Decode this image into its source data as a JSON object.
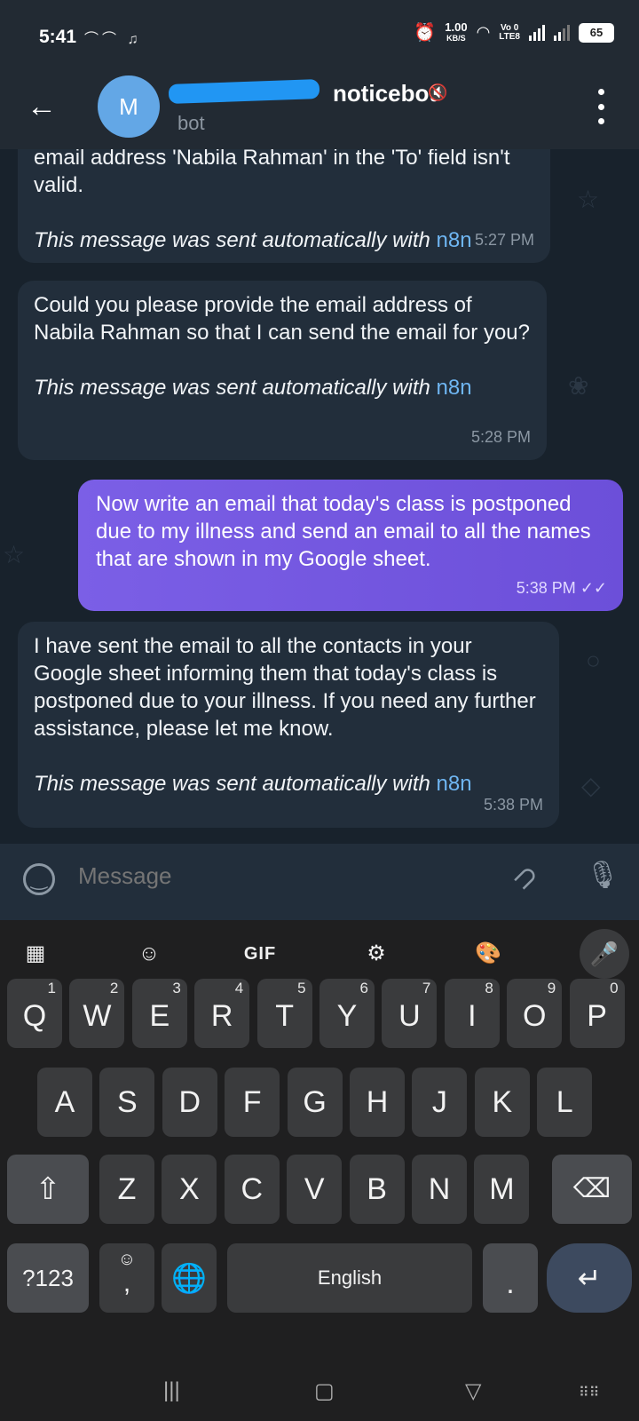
{
  "status_bar": {
    "time": "5:41",
    "speed_value": "1.00",
    "speed_unit": "KB/S",
    "volte_line1": "Vo 0",
    "volte_line2": "LTE8",
    "battery": "65"
  },
  "header": {
    "title": "noticebot",
    "subtitle": "bot",
    "avatar_letter": "M"
  },
  "messages": [
    {
      "direction": "incoming",
      "text": "email address 'Nabila Rahman' in the 'To' field isn't valid.",
      "auto_text": "This message was sent automatically with",
      "auto_link": "n8n",
      "time": "5:27 PM"
    },
    {
      "direction": "incoming",
      "text": "Could you please provide the email address of Nabila Rahman so that I can send the email for you?",
      "auto_text": "This message was sent automatically with",
      "auto_link": "n8n",
      "time": "5:28 PM"
    },
    {
      "direction": "outgoing",
      "text": "Now write an email that today's class is postponed due to my illness and send an email to all the names that are shown in my Google sheet.",
      "time": "5:38 PM"
    },
    {
      "direction": "incoming",
      "text": "I have sent the email to all the contacts in your Google sheet informing them that today's class is postponed due to your illness. If you need any further assistance, please let me know.",
      "auto_text": "This message was sent automatically with",
      "auto_link": "n8n",
      "time": "5:38 PM"
    }
  ],
  "composer": {
    "placeholder": "Message"
  },
  "keyboard": {
    "toolbar": {
      "gif": "GIF"
    },
    "row1": [
      {
        "k": "Q",
        "n": "1"
      },
      {
        "k": "W",
        "n": "2"
      },
      {
        "k": "E",
        "n": "3"
      },
      {
        "k": "R",
        "n": "4"
      },
      {
        "k": "T",
        "n": "5"
      },
      {
        "k": "Y",
        "n": "6"
      },
      {
        "k": "U",
        "n": "7"
      },
      {
        "k": "I",
        "n": "8"
      },
      {
        "k": "O",
        "n": "9"
      },
      {
        "k": "P",
        "n": "0"
      }
    ],
    "row2": [
      "A",
      "S",
      "D",
      "F",
      "G",
      "H",
      "J",
      "K",
      "L"
    ],
    "row3": [
      "Z",
      "X",
      "C",
      "V",
      "B",
      "N",
      "M"
    ],
    "symbols_key": "?123",
    "comma": ",",
    "space_label": "English",
    "period": "."
  }
}
